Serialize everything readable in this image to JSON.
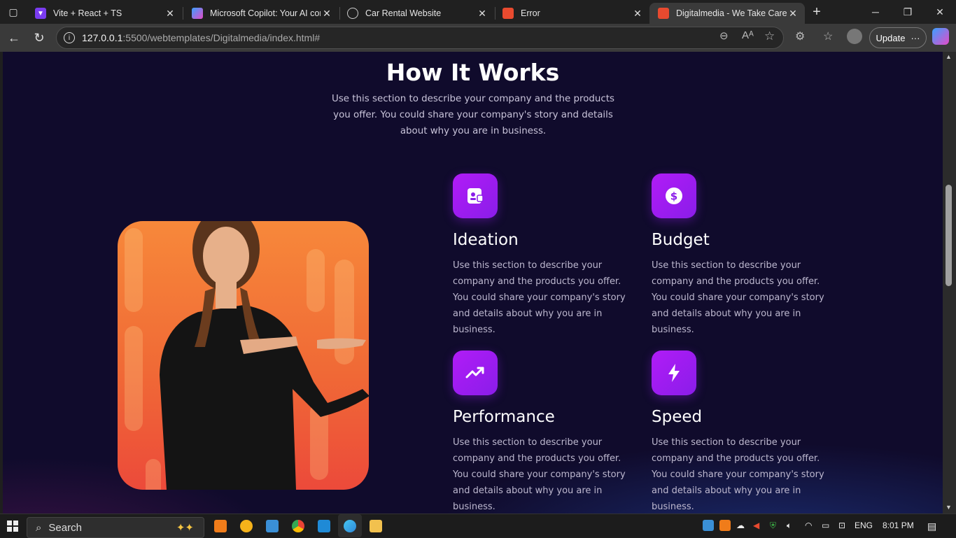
{
  "browser": {
    "tabs": [
      {
        "label": "Vite + React + TS",
        "icon": "vite-icon",
        "color": "#9b59ff"
      },
      {
        "label": "Microsoft Copilot: Your AI com",
        "icon": "copilot-icon",
        "color": "#3aa0ff"
      },
      {
        "label": "Car Rental Website",
        "icon": "globe-icon",
        "color": "#cccccc"
      },
      {
        "label": "Error",
        "icon": "template-icon",
        "color": "#e84a2f"
      },
      {
        "label": "Digitalmedia - We Take Care o",
        "icon": "template-icon",
        "color": "#e84a2f"
      }
    ],
    "url_host": "127.0.0.1",
    "url_path": ":5500/webtemplates/Digitalmedia/index.html#",
    "update_label": "Update"
  },
  "section": {
    "title": "How It Works",
    "intro": "Use this section to describe your company and the products you offer. You could share your company's story and details about why you are in business."
  },
  "features": [
    {
      "title": "Ideation",
      "icon": "id-card-icon",
      "desc": "Use this section to describe your company and the products you offer. You could share your company's story and details about why you are in business."
    },
    {
      "title": "Budget",
      "icon": "dollar-coin-icon",
      "desc": "Use this section to describe your company and the products you offer. You could share your company's story and details about why you are in business."
    },
    {
      "title": "Performance",
      "icon": "trending-up-icon",
      "desc": "Use this section to describe your company and the products you offer. You could share your company's story and details about why you are in business."
    },
    {
      "title": "Speed",
      "icon": "lightning-bolt-icon",
      "desc": "Use this section to describe your company and the products you offer. You could share your company's story and details about why you are in business."
    }
  ],
  "taskbar": {
    "search_label": "Search",
    "language": "ENG",
    "time": "8:01 PM"
  },
  "colors": {
    "page_bg": "#100b2c",
    "accent_purple": "#a01cf2",
    "photo_orange": "#f7883a"
  }
}
